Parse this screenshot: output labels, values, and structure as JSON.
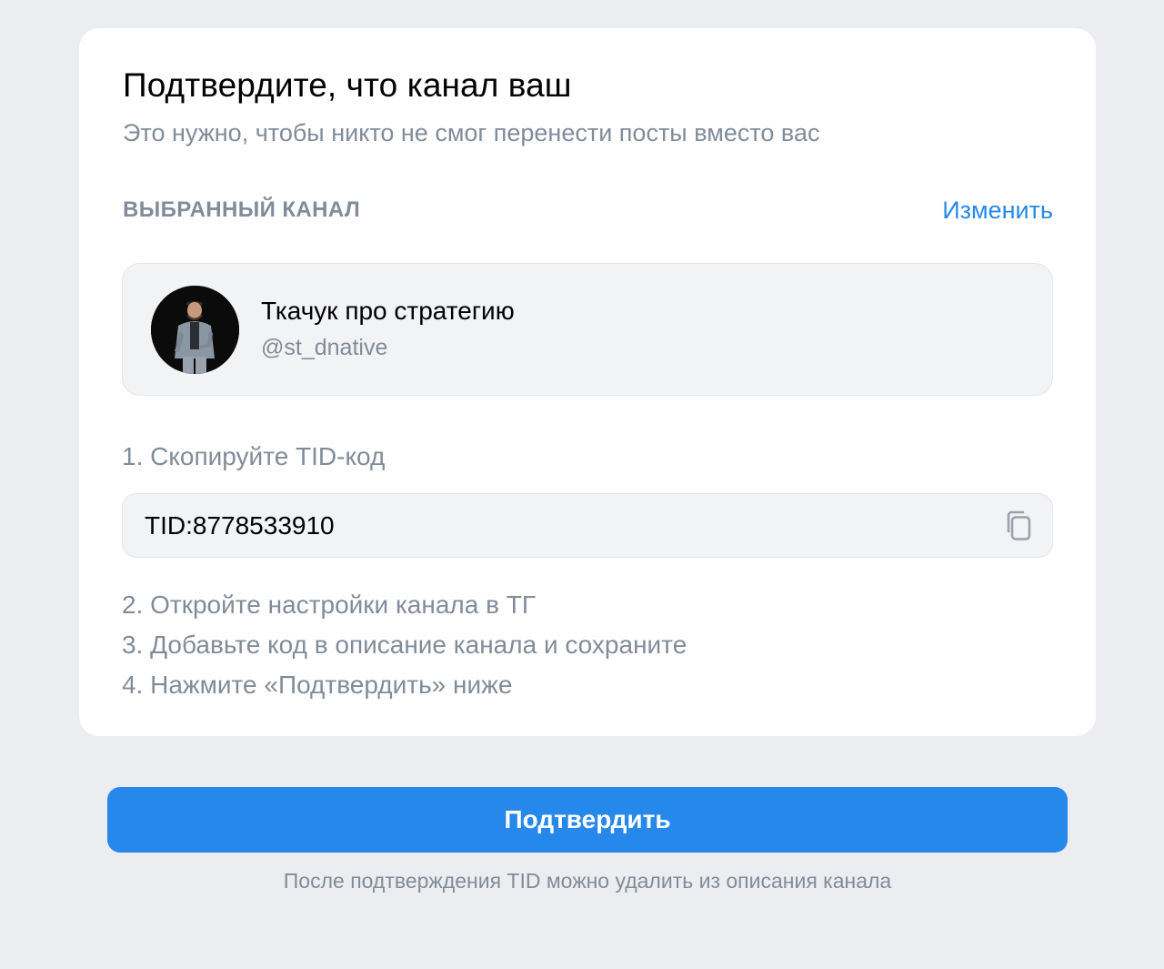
{
  "card": {
    "title": "Подтвердите, что канал ваш",
    "subtitle": "Это нужно, чтобы никто не смог перенести посты вместо вас"
  },
  "selected_channel": {
    "section_label": "ВЫБРАННЫЙ КАНАЛ",
    "change_label": "Изменить",
    "name": "Ткачук про стратегию",
    "handle": "@st_dnative",
    "avatar_icon": "avatar-photo"
  },
  "steps": {
    "step1": "1. Скопируйте TID-код",
    "tid_value": "TID:8778533910",
    "copy_icon": "copy-icon",
    "step2": "2. Откройте настройки канала в ТГ",
    "step3": "3. Добавьте код в описание канала и сохраните",
    "step4": "4. Нажмите «Подтвердить» ниже"
  },
  "footer": {
    "confirm_label": "Подтвердить",
    "note": "После подтверждения TID можно удалить из описания канала"
  },
  "colors": {
    "accent": "#2688eb",
    "secondary_text": "#818c99",
    "background": "#ebedf0"
  }
}
